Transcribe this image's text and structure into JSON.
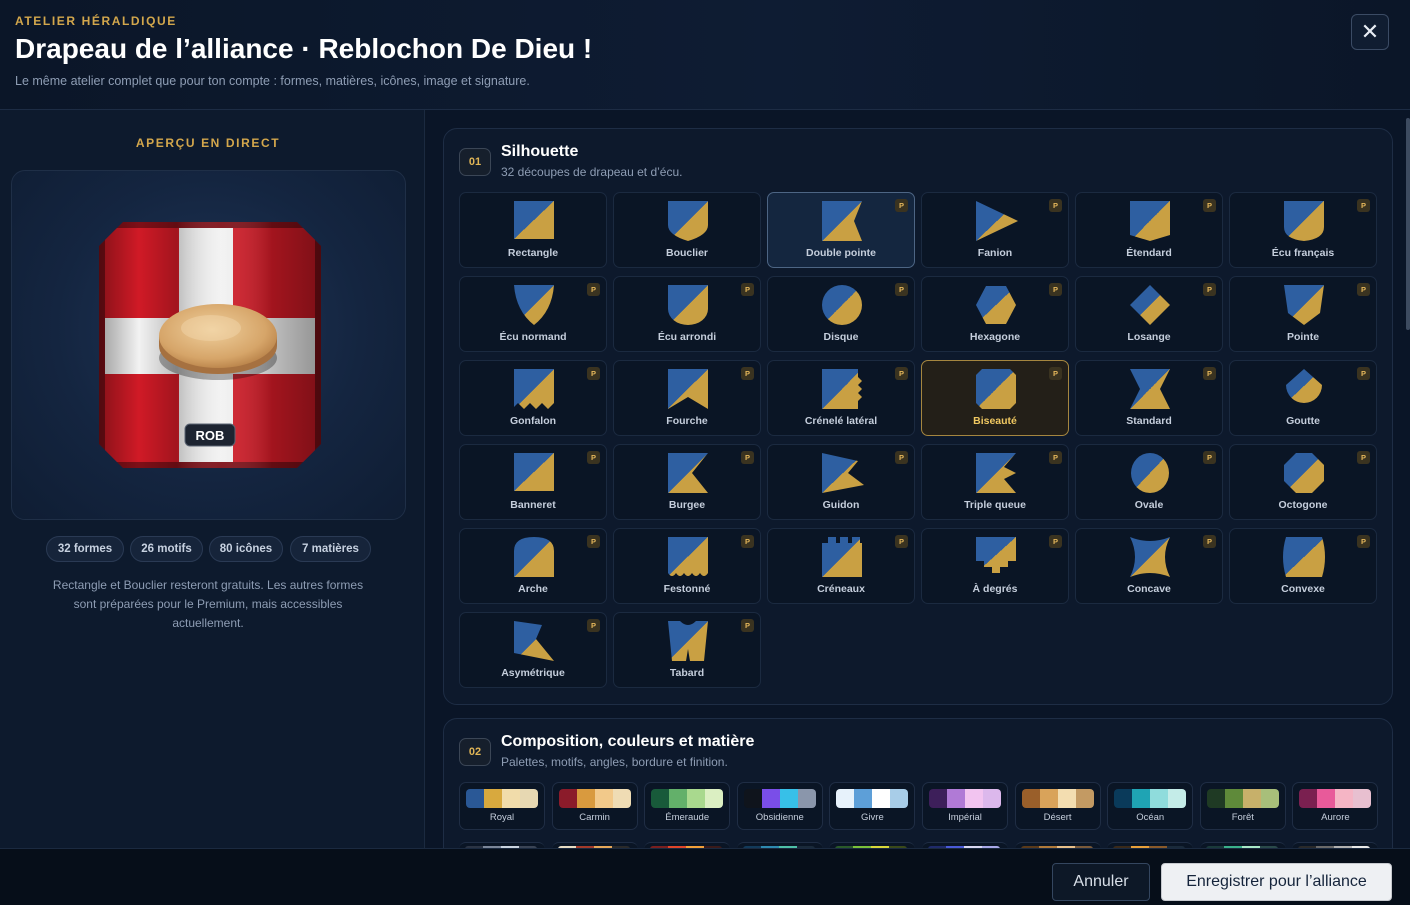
{
  "header": {
    "kicker": "ATELIER HÉRALDIQUE",
    "title": "Drapeau de l’alliance · Reblochon De Dieu !",
    "subtitle": "Le même atelier complet que pour ton compte : formes, matières, icônes, image et signature.",
    "close_icon": "close-icon",
    "close_glyph": "✕"
  },
  "preview": {
    "label": "APERÇU EN DIRECT",
    "tag": "ROB",
    "flag_colors": {
      "red": "#d01a26",
      "white": "#f2f2f2",
      "frame": "#7e0f17"
    },
    "chips": [
      "32 formes",
      "26 motifs",
      "80 icônes",
      "7 matières"
    ],
    "notice": "Rectangle et Bouclier resteront gratuits. Les autres formes sont préparées pour le Premium, mais accessibles actuellement."
  },
  "silhouette": {
    "number": "01",
    "title": "Silhouette",
    "subtitle": "32 découpes de drapeau et d’écu.",
    "premium_badge": "P",
    "icon_colors": {
      "blue": "#2e5fa1",
      "gold": "#c9a043"
    },
    "shapes": [
      {
        "label": "Rectangle",
        "premium": false
      },
      {
        "label": "Bouclier",
        "premium": false
      },
      {
        "label": "Double pointe",
        "premium": true
      },
      {
        "label": "Fanion",
        "premium": true
      },
      {
        "label": "Étendard",
        "premium": true
      },
      {
        "label": "Écu français",
        "premium": true
      },
      {
        "label": "Écu normand",
        "premium": true
      },
      {
        "label": "Écu arrondi",
        "premium": true
      },
      {
        "label": "Disque",
        "premium": true
      },
      {
        "label": "Hexagone",
        "premium": true
      },
      {
        "label": "Losange",
        "premium": true
      },
      {
        "label": "Pointe",
        "premium": true
      },
      {
        "label": "Gonfalon",
        "premium": true
      },
      {
        "label": "Fourche",
        "premium": true
      },
      {
        "label": "Crénelé latéral",
        "premium": true
      },
      {
        "label": "Biseauté",
        "premium": true
      },
      {
        "label": "Standard",
        "premium": true
      },
      {
        "label": "Goutte",
        "premium": true
      },
      {
        "label": "Banneret",
        "premium": true
      },
      {
        "label": "Burgee",
        "premium": true
      },
      {
        "label": "Guidon",
        "premium": true
      },
      {
        "label": "Triple queue",
        "premium": true
      },
      {
        "label": "Ovale",
        "premium": true
      },
      {
        "label": "Octogone",
        "premium": true
      },
      {
        "label": "Arche",
        "premium": true
      },
      {
        "label": "Festonné",
        "premium": true
      },
      {
        "label": "Créneaux",
        "premium": true
      },
      {
        "label": "À degrés",
        "premium": true
      },
      {
        "label": "Concave",
        "premium": true
      },
      {
        "label": "Convexe",
        "premium": true
      },
      {
        "label": "Asymétrique",
        "premium": true
      },
      {
        "label": "Tabard",
        "premium": true
      }
    ],
    "hovered": "Double pointe",
    "selected": "Biseauté"
  },
  "composition": {
    "number": "02",
    "title": "Composition, couleurs et matière",
    "subtitle": "Palettes, motifs, angles, bordure et finition.",
    "palettes": [
      {
        "label": "Royal",
        "colors": [
          "#2a5896",
          "#d8a93e",
          "#f1dcaa",
          "#e7d8b2"
        ]
      },
      {
        "label": "Carmin",
        "colors": [
          "#8b1b2a",
          "#d99a3e",
          "#f2c98a",
          "#efdcb4"
        ]
      },
      {
        "label": "Émeraude",
        "colors": [
          "#185a3a",
          "#63b06a",
          "#a9d98e",
          "#dbefc2"
        ]
      },
      {
        "label": "Obsidienne",
        "colors": [
          "#0f141c",
          "#7a4ee8",
          "#37c0e8",
          "#8a96ab"
        ]
      },
      {
        "label": "Givre",
        "colors": [
          "#e7f2fb",
          "#5d9fd8",
          "#ffffff",
          "#a8cde8"
        ]
      },
      {
        "label": "Impérial",
        "colors": [
          "#3d1f5a",
          "#b07ad6",
          "#f2c4f0",
          "#dcb8ec"
        ]
      },
      {
        "label": "Désert",
        "colors": [
          "#9a5f2a",
          "#d9a35a",
          "#f3ddb0",
          "#c39a63"
        ]
      },
      {
        "label": "Océan",
        "colors": [
          "#0a3a5a",
          "#1fa4b4",
          "#8fdcdc",
          "#c4ece8"
        ]
      },
      {
        "label": "Forêt",
        "colors": [
          "#1f3a24",
          "#5f8a3a",
          "#c7b06a",
          "#a8bf7a"
        ]
      },
      {
        "label": "Aurore",
        "colors": [
          "#7a2050",
          "#e85a9a",
          "#f5b5c5",
          "#e8c0d0"
        ]
      }
    ],
    "palettes_row2": [
      [
        "#2b3444",
        "#7b8699",
        "#c9d3e0",
        "#3a4455"
      ],
      [
        "#e6dcc4",
        "#a33a2a",
        "#e6a85a",
        "#2a2a2a"
      ],
      [
        "#7a1f1f",
        "#e0452a",
        "#f2a03a",
        "#3a1a1a"
      ],
      [
        "#123a5a",
        "#2e8ab0",
        "#4ec0a8",
        "#1a2a3a"
      ],
      [
        "#2a5a2a",
        "#7ac03a",
        "#d8d83a",
        "#3a4a1a"
      ],
      [
        "#1f2a6a",
        "#4a5ad8",
        "#d8d8f2",
        "#a8a8e8"
      ],
      [
        "#5a3a1a",
        "#b07a3a",
        "#e8c08a",
        "#7a5a3a"
      ],
      [
        "#3a2a1a",
        "#e8a03a",
        "#8a5a2a",
        "#1a2a3a"
      ],
      [
        "#1a3a3a",
        "#3ab08a",
        "#a8e8c8",
        "#2a4a4a"
      ],
      [
        "#2a2a2a",
        "#6a6a6a",
        "#b0b0b0",
        "#e8e8e8"
      ]
    ]
  },
  "footer": {
    "cancel": "Annuler",
    "save": "Enregistrer pour l’alliance"
  }
}
